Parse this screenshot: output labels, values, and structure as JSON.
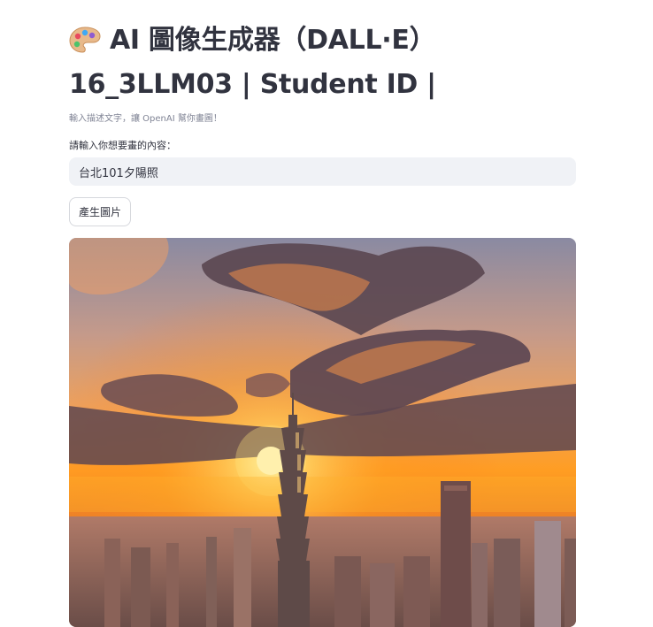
{
  "app": {
    "title_line1": "AI 圖像生成器（DALL·E）",
    "title_line2": "16_3LLM03 | Student ID |",
    "title_icon": "artist-palette-icon",
    "caption": "輸入描述文字，讓 OpenAI 幫你畫圖！"
  },
  "prompt": {
    "label": "請輸入你想要畫的內容：",
    "value": "台北101夕陽照"
  },
  "button": {
    "label": "產生圖片"
  },
  "image": {
    "subject": "generated-image",
    "palette": {
      "sky_top": "#7c7c94",
      "sun": "#fff3a0",
      "glow": "#ff9a1f",
      "cloud_dark": "#5a4650",
      "city": "#6a5550"
    }
  }
}
